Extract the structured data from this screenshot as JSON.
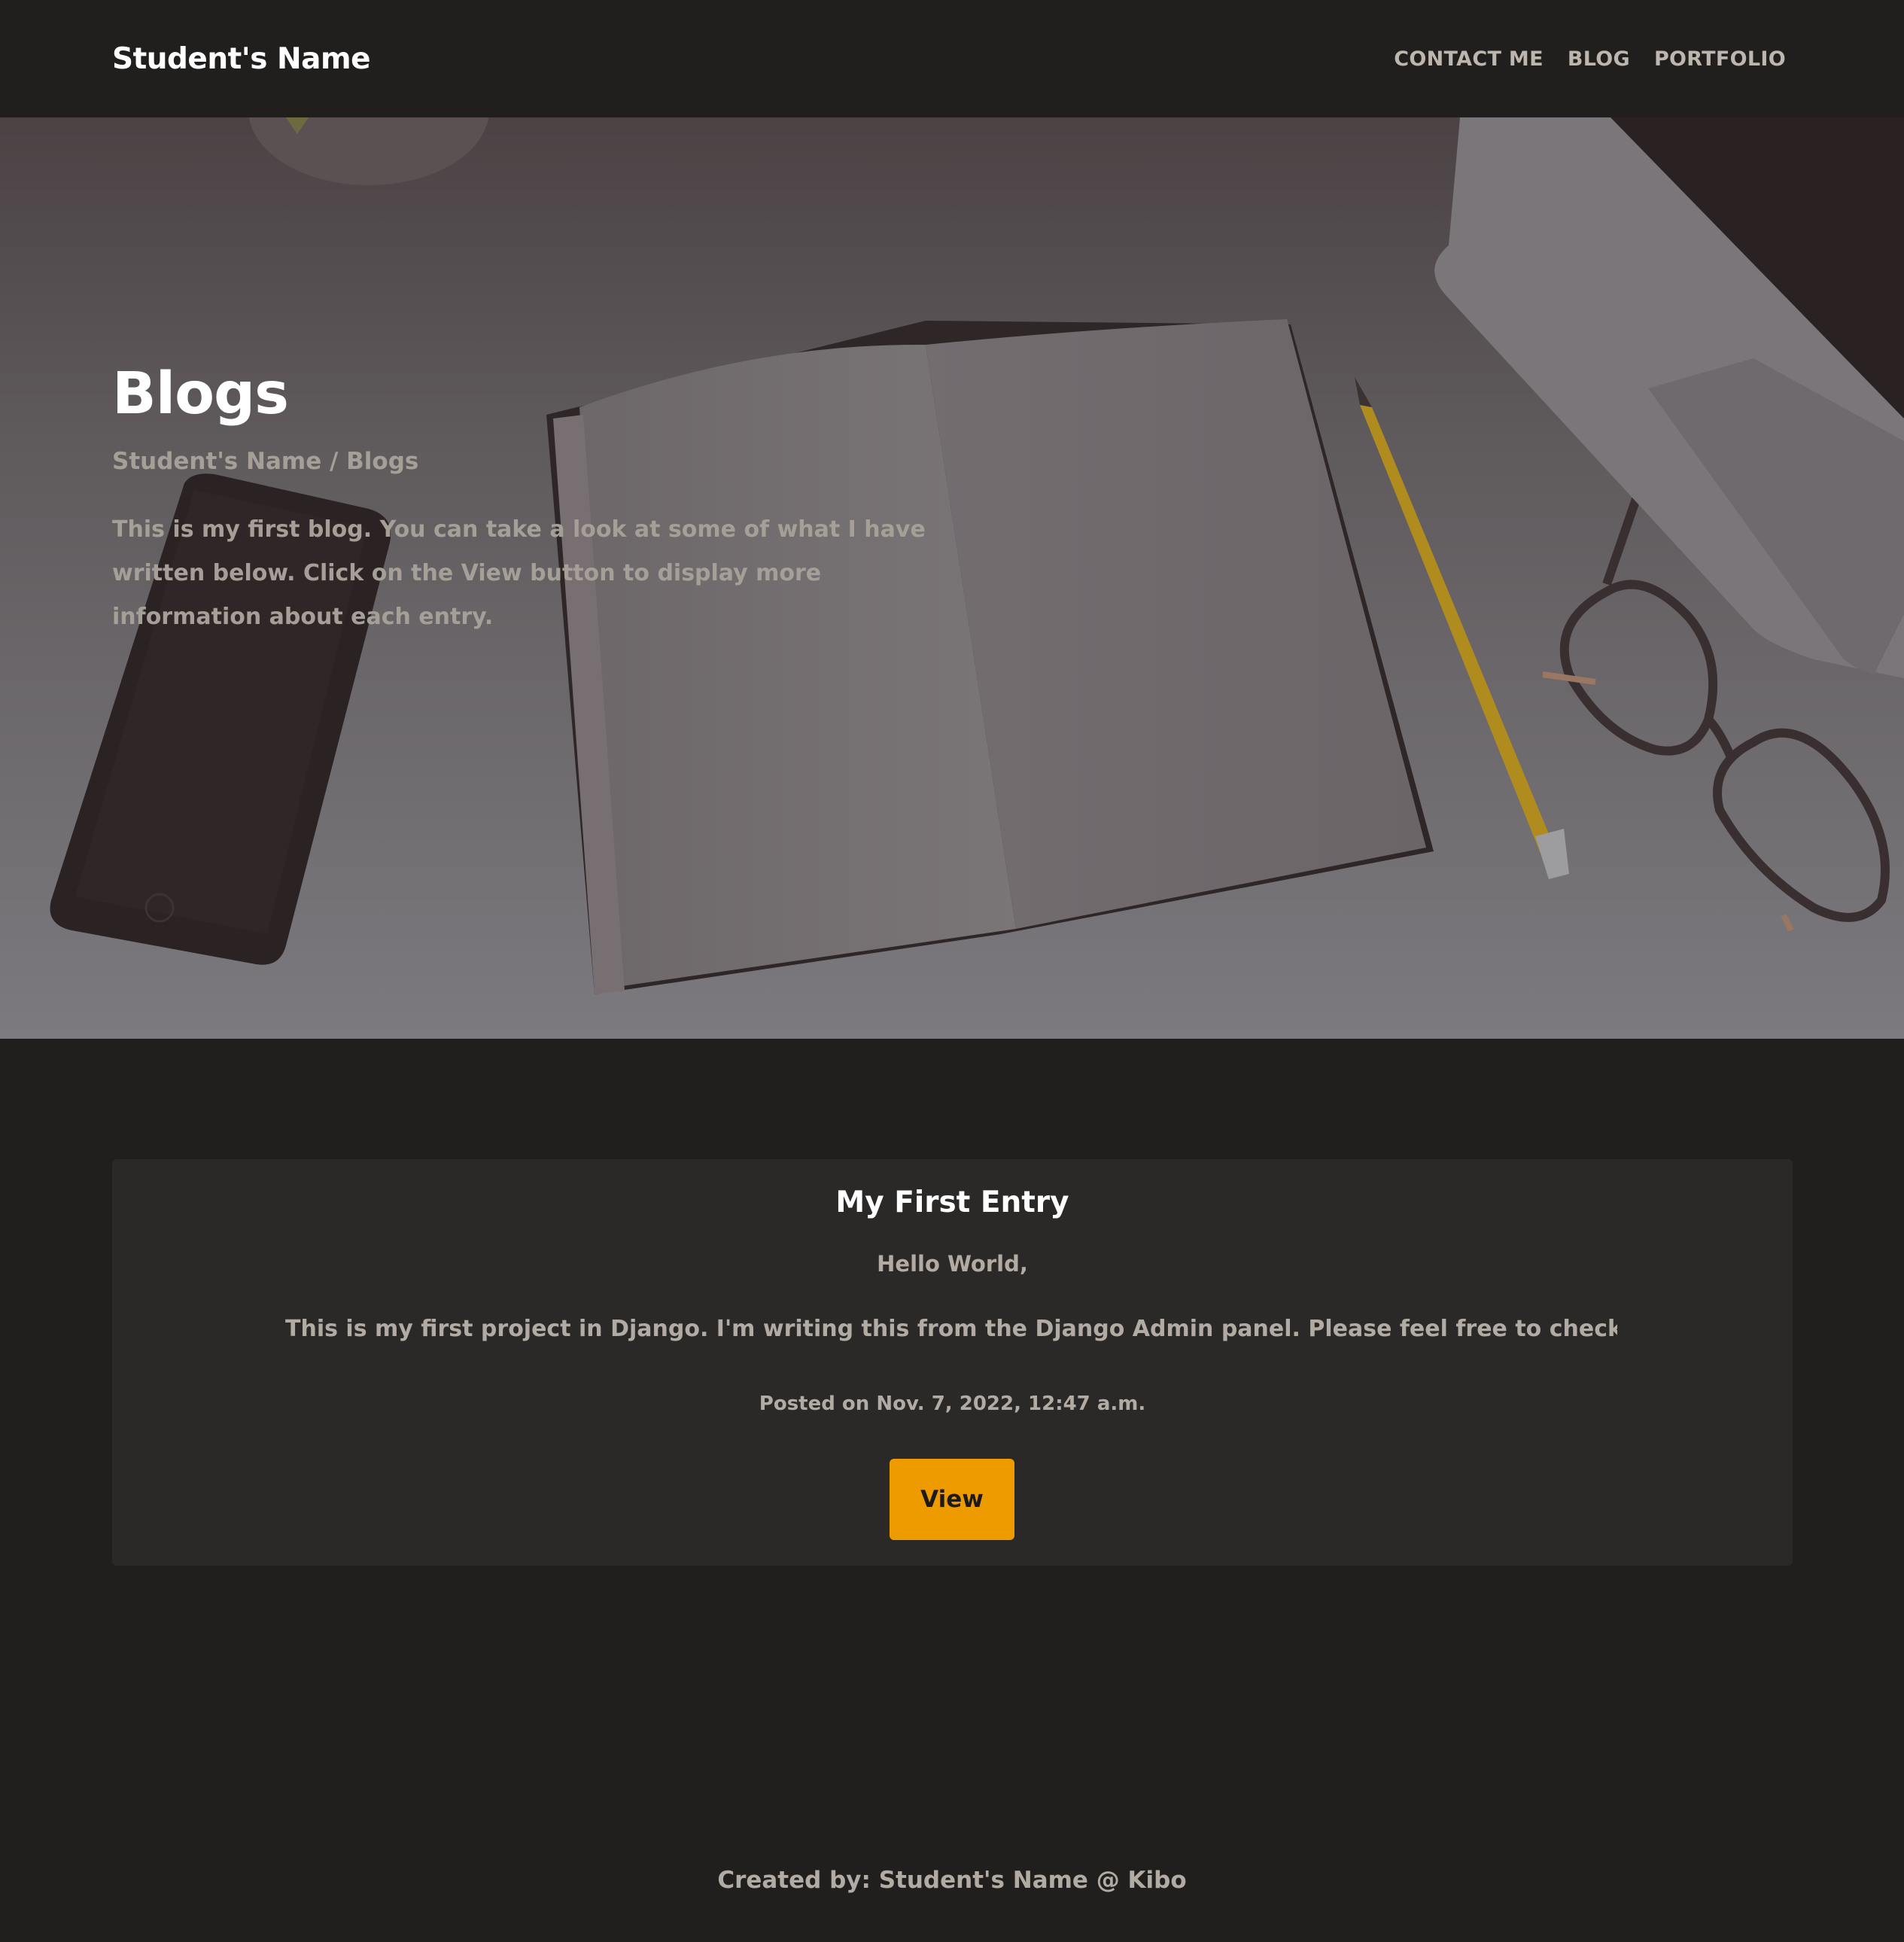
{
  "navbar": {
    "brand": "Student's Name",
    "links": [
      {
        "label": "CONTACT ME"
      },
      {
        "label": "BLOG"
      },
      {
        "label": "PORTFOLIO"
      }
    ]
  },
  "hero": {
    "title": "Blogs",
    "breadcrumb": "Student's Name / Blogs",
    "description": "This is my first blog. You can take a look at some of what I have written below. Click on the View button to display more information about each entry."
  },
  "entries": [
    {
      "title": "My First Entry",
      "greeting": "Hello World,",
      "body": "This is my first project in Django. I'm writing this from the Django Admin panel. Please feel free to check out a link t",
      "date": "Posted on Nov. 7, 2022, 12:47 a.m.",
      "button_label": "View"
    }
  ],
  "footer": {
    "text": "Created by: Student's Name @ Kibo"
  },
  "colors": {
    "background": "#201f1e",
    "card": "#2a2928",
    "accent": "#ee9b00",
    "muted_text": "#b2aba3"
  }
}
